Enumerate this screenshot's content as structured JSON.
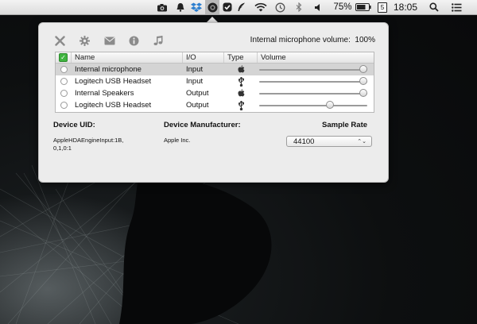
{
  "menubar": {
    "battery_percent": "75%",
    "date_day": "5",
    "time": "18:05",
    "icons": [
      "camera-icon",
      "bell-icon",
      "dropbox-icon",
      "audio-switcher-icon",
      "checkmark-shield-icon",
      "feather-icon",
      "wifi-icon",
      "time-machine-icon",
      "bluetooth-icon",
      "speaker-icon",
      "battery-icon",
      "calendar-icon",
      "spotlight-search-icon",
      "notification-center-icon"
    ]
  },
  "popover": {
    "toolbar": {
      "icons": [
        "close-x-icon",
        "gear-icon",
        "mail-icon",
        "info-icon",
        "music-note-icon"
      ]
    },
    "volume_label": "Internal microphone volume:",
    "volume_value": "100%",
    "table": {
      "headers": {
        "name": "Name",
        "io": "I/O",
        "type": "Type",
        "volume": "Volume"
      },
      "rows": [
        {
          "name": "Internal microphone",
          "io": "Input",
          "type_icon": "apple-icon",
          "volume": 1.0,
          "selected": true
        },
        {
          "name": "Logitech USB Headset",
          "io": "Input",
          "type_icon": "usb-icon",
          "volume": 1.0,
          "selected": false
        },
        {
          "name": "Internal Speakers",
          "io": "Output",
          "type_icon": "apple-icon",
          "volume": 1.0,
          "selected": false
        },
        {
          "name": "Logitech USB Headset",
          "io": "Output",
          "type_icon": "usb-icon",
          "volume": 0.68,
          "selected": false
        }
      ]
    },
    "details": {
      "uid_label": "Device UID:",
      "uid_value_line1": "AppleHDAEngineInput:1B,",
      "uid_value_line2": "0,1,0:1",
      "manufacturer_label": "Device Manufacturer:",
      "manufacturer_value": "Apple Inc.",
      "sample_rate_label": "Sample Rate",
      "sample_rate_value": "44100",
      "sample_rate_arrows": "⌃⌄"
    }
  }
}
